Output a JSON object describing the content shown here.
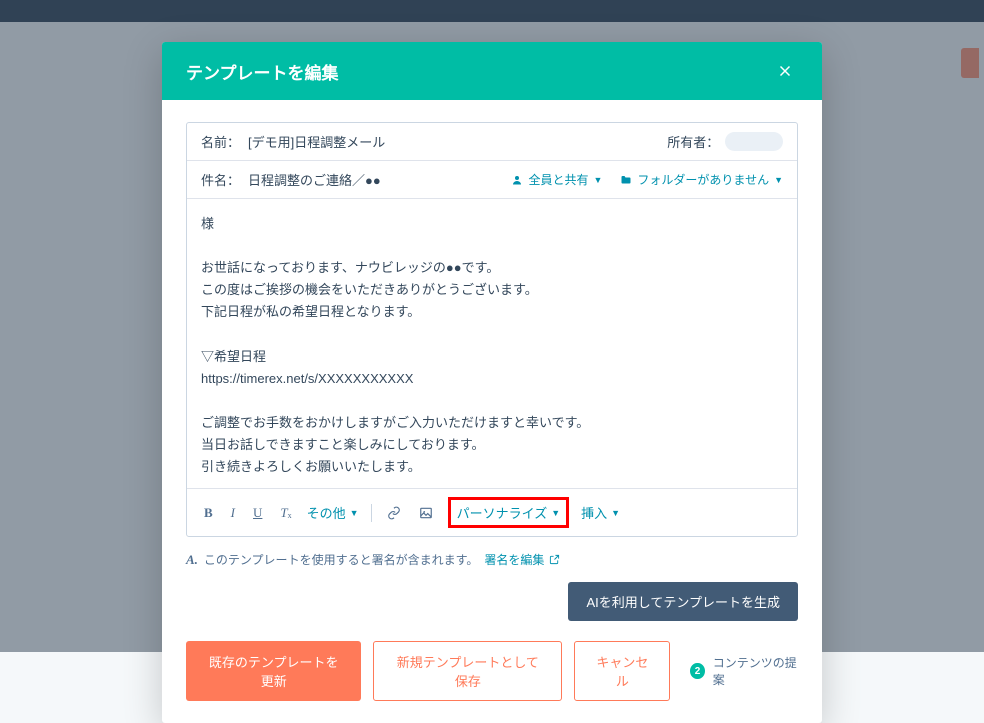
{
  "modal": {
    "title": "テンプレートを編集",
    "name_label": "名前：",
    "name_value": "[デモ用]日程調整メール",
    "owner_label": "所有者：",
    "subject_label": "件名：",
    "subject_value": "日程調整のご連絡／●●",
    "share_label": "全員と共有",
    "folder_label": "フォルダーがありません"
  },
  "body": {
    "l1": "様",
    "l2": "お世話になっております、ナウビレッジの●●です。",
    "l3": "この度はご挨拶の機会をいただきありがとうございます。",
    "l4": "下記日程が私の希望日程となります。",
    "l5": "▽希望日程",
    "l6": "https://timerex.net/s/XXXXXXXXXXX",
    "l7": "ご調整でお手数をおかけしますがご入力いただけますと幸いです。",
    "l8": "当日お話しできますこと楽しみにしております。",
    "l9": "引き続きよろしくお願いいたします。"
  },
  "toolbar": {
    "other": "その他",
    "personalize": "パーソナライズ",
    "insert": "挿入"
  },
  "signature": {
    "text": "このテンプレートを使用すると署名が含まれます。",
    "edit": "署名を編集"
  },
  "buttons": {
    "ai": "AIを利用してテンプレートを生成",
    "update": "既存のテンプレートを更新",
    "save_new": "新規テンプレートとして保存",
    "cancel": "キャンセル"
  },
  "suggest": {
    "count": "2",
    "label": "コンテンツの提案"
  }
}
